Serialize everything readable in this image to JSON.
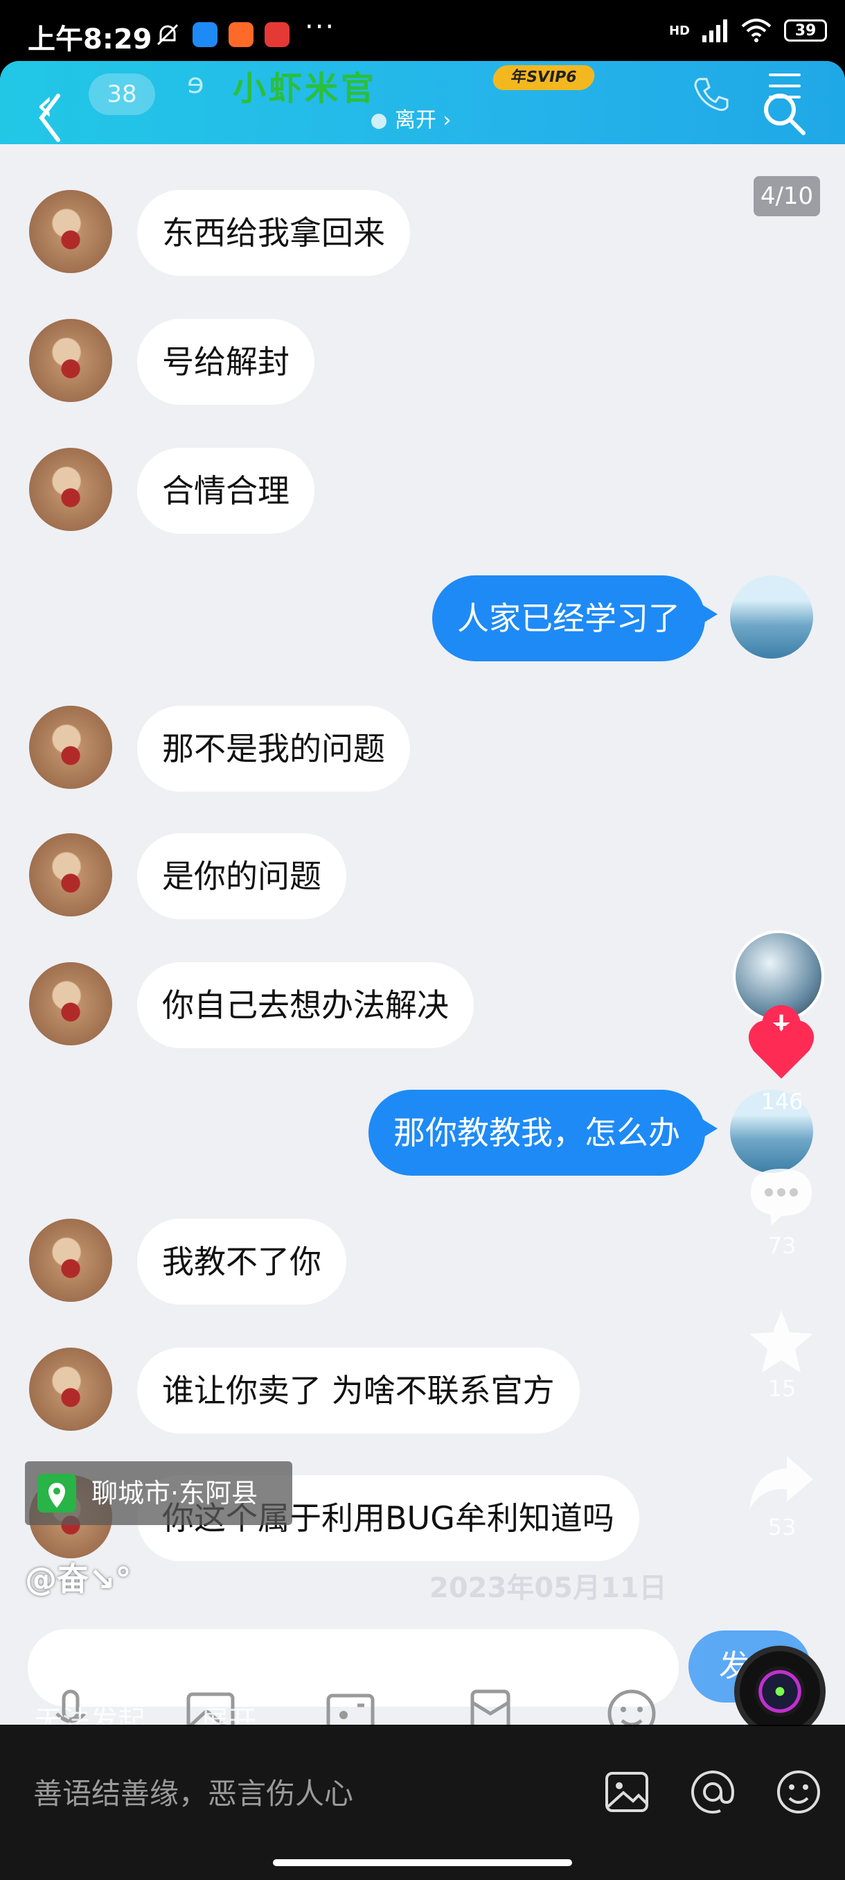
{
  "status_bar": {
    "time": "上午8:29",
    "dots": "···",
    "network": "HD",
    "battery": "39"
  },
  "chat_header": {
    "back_icon": "chevron-left-icon",
    "unread_count": "38",
    "title": "小虾米官",
    "svip_badge": "年SVIP6",
    "status": "离开 ›"
  },
  "page_indicator": "4/10",
  "messages": [
    {
      "side": "left",
      "text": "东西给我拿回来"
    },
    {
      "side": "left",
      "text": "号给解封"
    },
    {
      "side": "left",
      "text": "合情合理"
    },
    {
      "side": "right",
      "text": "人家已经学习了"
    },
    {
      "side": "left",
      "text": "那不是我的问题"
    },
    {
      "side": "left",
      "text": "是你的问题"
    },
    {
      "side": "left",
      "text": "你自己去想办法解决"
    },
    {
      "side": "right",
      "text": "那你教教我，怎么办"
    },
    {
      "side": "left",
      "text": "我教不了你"
    },
    {
      "side": "left",
      "text": "谁让你卖了 为啥不联系官方"
    },
    {
      "side": "left",
      "text": "你这个属于利用BUG牟利知道吗"
    }
  ],
  "side_actions": {
    "likes": "146",
    "comments": "73",
    "favorites": "15",
    "shares": "53",
    "follow_label": "+"
  },
  "overlay": {
    "location": "聊城市·东阿县",
    "author": "@奋↘°",
    "date_watermark": "2023年05月11日",
    "caption": "无法发起…",
    "expand": "展开",
    "send_label": "发"
  },
  "comment_bar": {
    "placeholder": "善语结善缘，恶言伤人心"
  }
}
